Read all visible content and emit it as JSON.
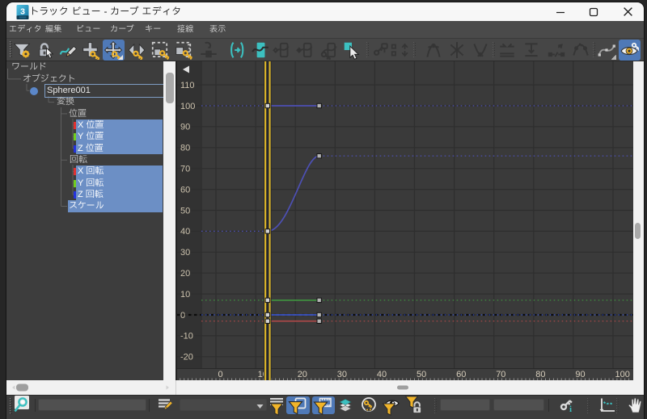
{
  "window": {
    "title": "トラック ビュー - カーブ エディタ",
    "app_icon": "3ds-max-logo",
    "controls": [
      {
        "name": "minimize-button"
      },
      {
        "name": "maximize-button"
      },
      {
        "name": "close-button"
      }
    ]
  },
  "menu_bar": {
    "items": [
      {
        "name": "menu-editor",
        "label": "エディタ"
      },
      {
        "name": "menu-edit",
        "label": "編集"
      },
      {
        "name": "menu-view",
        "label": "ビュー"
      },
      {
        "name": "menu-curves",
        "label": "カーブ"
      },
      {
        "name": "menu-keys",
        "label": "キー"
      },
      {
        "name": "menu-tangents",
        "label": "接線"
      },
      {
        "name": "menu-display",
        "label": "表示"
      }
    ]
  },
  "toolbar": {
    "buttons": [
      {
        "name": "filters-button",
        "icon": "filter-gear-icon",
        "state": "normal"
      },
      {
        "name": "lock-selection-button",
        "icon": "lock-cursor-icon",
        "state": "normal"
      },
      {
        "name": "draw-curves-button",
        "icon": "draw-curve-pencil-icon",
        "state": "normal"
      },
      {
        "name": "add-keys-button",
        "icon": "add-key-icon",
        "state": "normal"
      },
      {
        "name": "move-keys-button",
        "icon": "move-key-icon",
        "state": "selected",
        "flyout": true
      },
      {
        "name": "slide-keys-button",
        "icon": "slide-key-icon",
        "state": "normal"
      },
      {
        "name": "scale-keys-button",
        "icon": "scale-keys-icon",
        "state": "normal"
      },
      {
        "name": "scale-values-button",
        "icon": "scale-values-icon",
        "state": "normal"
      },
      {
        "name": "retime-tool-button",
        "icon": "retime-icon",
        "state": "disabled"
      },
      {
        "name": "simplify-curve-button",
        "icon": "simplify-curve-icon",
        "state": "normal"
      },
      {
        "name": "region-keys-tool-button",
        "icon": "region-keys-icon",
        "state": "normal"
      },
      {
        "name": "show-selected-key-stats-button",
        "icon": "curve-box-diamond-icon",
        "state": "disabled"
      },
      {
        "name": "lock-tangents-button",
        "icon": "curve-box-diamond2-icon",
        "state": "disabled"
      },
      {
        "name": "lock-keys-button",
        "icon": "curve-box-key-icon",
        "state": "disabled"
      },
      {
        "name": "select-keys-by-time-button",
        "icon": "select-cursor-icon",
        "state": "normal"
      },
      {
        "name": "randomize-keys-button",
        "icon": "key-hammer-icon",
        "state": "disabled"
      },
      {
        "name": "spinner-snap-button",
        "icon": "grid-arrows-icon",
        "state": "disabled"
      },
      {
        "name": "set-tangents-auto-button",
        "icon": "tangent-auto-icon",
        "state": "disabled"
      },
      {
        "name": "set-tangents-spline-button",
        "icon": "tangent-spline-icon",
        "state": "disabled"
      },
      {
        "name": "set-tangents-fast-button",
        "icon": "tangent-fast-icon",
        "state": "disabled"
      },
      {
        "name": "set-tangents-slow-button",
        "icon": "tangent-slow-icon",
        "state": "disabled"
      },
      {
        "name": "set-tangents-step-button",
        "icon": "tangent-step-icon",
        "state": "disabled"
      },
      {
        "name": "set-tangents-linear-button",
        "icon": "tangent-linear-icon",
        "state": "disabled"
      },
      {
        "name": "set-tangents-smooth-button",
        "icon": "tangent-smooth-icon",
        "state": "disabled"
      },
      {
        "name": "show-tangents-toggle-button",
        "icon": "curve-nodes-icon",
        "state": "normal",
        "flyout": true
      },
      {
        "name": "show-keyable-icons-button",
        "icon": "keyable-eye-icon",
        "state": "selected"
      }
    ]
  },
  "tree": {
    "rows": [
      {
        "label": "ワールド",
        "selected": false
      },
      {
        "label": "オブジェクト",
        "selected": false
      },
      {
        "label": "Sphere001",
        "selected": false,
        "boxed": true,
        "node_icon": "object-dot-icon"
      },
      {
        "label": "変換",
        "selected": false
      },
      {
        "label": "位置",
        "selected": false
      },
      {
        "label": "X 位置",
        "selected": true,
        "axis_color": "#e03131"
      },
      {
        "label": "Y 位置",
        "selected": true,
        "axis_color": "#6fce1f"
      },
      {
        "label": "Z 位置",
        "selected": true,
        "axis_color": "#2433dd"
      },
      {
        "label": "回転",
        "selected": false
      },
      {
        "label": "X 回転",
        "selected": true,
        "axis_color": "#e03131"
      },
      {
        "label": "Y 回転",
        "selected": true,
        "axis_color": "#6fce1f"
      },
      {
        "label": "Z 回転",
        "selected": true,
        "axis_color": "#2433dd"
      },
      {
        "label": "スケール",
        "selected": true
      }
    ]
  },
  "chart_data": {
    "type": "line",
    "title": "",
    "xlabel": "",
    "ylabel": "",
    "x_ticks": [
      0,
      10,
      20,
      30,
      40,
      50,
      60,
      70,
      80,
      90,
      100
    ],
    "y_ticks": [
      110,
      100,
      90,
      80,
      70,
      60,
      50,
      40,
      30,
      20,
      10,
      0,
      -10,
      -20
    ],
    "grid": true,
    "time_slider_frame": 13,
    "zero_line_value": 0,
    "collapse_arrow": "left-triangle-icon",
    "series": [
      {
        "name": "curve-blue-high",
        "color": "#4d50b4",
        "keys": [
          {
            "frame": 13,
            "value": 100
          },
          {
            "frame": 26,
            "value": 100
          }
        ],
        "interpolation": "flat"
      },
      {
        "name": "curve-blue-ease",
        "color": "#4d50b4",
        "keys": [
          {
            "frame": 13,
            "value": 40
          },
          {
            "frame": 26,
            "value": 76
          }
        ],
        "interpolation": "ease"
      },
      {
        "name": "curve-green",
        "color": "#3f8f3f",
        "keys": [
          {
            "frame": 13,
            "value": 7
          },
          {
            "frame": 26,
            "value": 7
          }
        ],
        "interpolation": "flat"
      },
      {
        "name": "curve-blue-zero",
        "color": "#3b55c8",
        "keys": [
          {
            "frame": 13,
            "value": 0
          },
          {
            "frame": 26,
            "value": 0
          }
        ],
        "interpolation": "flat"
      },
      {
        "name": "curve-red",
        "color": "#a84848",
        "keys": [
          {
            "frame": 13,
            "value": -3
          },
          {
            "frame": 26,
            "value": -3
          }
        ],
        "interpolation": "flat"
      }
    ]
  },
  "bottom_bar": {
    "items": [
      {
        "name": "zoom-region-button",
        "type": "button",
        "icon": "zoom-magnifier-icon",
        "state": "toggled-light"
      },
      {
        "name": "track-name-filter-input",
        "type": "input",
        "value": "",
        "placeholder": ""
      },
      {
        "name": "edit-track-set-button",
        "type": "button",
        "icon": "track-set-pen-icon",
        "state": "normal"
      },
      {
        "name": "track-set-select",
        "type": "select",
        "value": ""
      },
      {
        "name": "filters-list-button",
        "type": "button",
        "icon": "funnel-lines-icon",
        "state": "normal"
      },
      {
        "name": "show-only-selected-tracks-button",
        "type": "button",
        "icon": "funnel-panel-icon",
        "state": "selected"
      },
      {
        "name": "show-only-animated-tracks-button",
        "type": "button",
        "icon": "funnel-film-icon",
        "state": "selected"
      },
      {
        "name": "show-all-tracks-button",
        "type": "button",
        "icon": "layers-stack-icon",
        "state": "normal"
      },
      {
        "name": "controllers-filter-button",
        "type": "button",
        "icon": "circle-key-icon",
        "state": "normal"
      },
      {
        "name": "show-hidden-tracks-button",
        "type": "button",
        "icon": "eye-funnel-icon",
        "state": "normal"
      },
      {
        "name": "locked-tracks-button",
        "type": "button",
        "icon": "lock-funnel-icon",
        "state": "normal"
      },
      {
        "name": "key-time-input",
        "type": "input",
        "value": "",
        "placeholder": ""
      },
      {
        "name": "key-value-input",
        "type": "input",
        "value": "",
        "placeholder": ""
      },
      {
        "name": "key-info-button",
        "type": "button",
        "icon": "key-info-icon",
        "state": "normal"
      },
      {
        "name": "interactive-update-button",
        "type": "button",
        "icon": "axes-curve-icon",
        "state": "normal"
      },
      {
        "name": "pan-button",
        "type": "button",
        "icon": "hand-icon",
        "state": "normal"
      }
    ]
  },
  "colors": {
    "selection_highlight": "#6c8fc5",
    "button_selected": "#4f79b7",
    "accent_yellow": "#f0b42a",
    "accent_teal": "#3cc0c0",
    "time_slider_yellow": "#d9b42a",
    "graph_background": "#3a3a3a",
    "panel_background": "#3d3d3d",
    "titlebar_background": "#f7f7f7"
  }
}
